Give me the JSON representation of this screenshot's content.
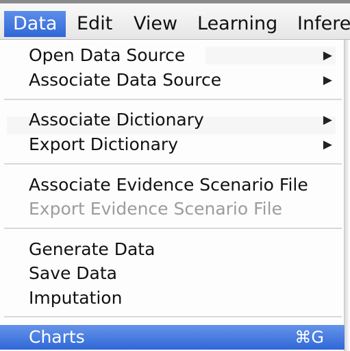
{
  "menubar": {
    "items": [
      {
        "label": "Data"
      },
      {
        "label": "Edit"
      },
      {
        "label": "View"
      },
      {
        "label": "Learning"
      },
      {
        "label": "Infere"
      }
    ]
  },
  "menu": {
    "groups": [
      [
        {
          "label": "Open Data Source",
          "submenu": true
        },
        {
          "label": "Associate Data Source",
          "submenu": true
        }
      ],
      [
        {
          "label": "Associate Dictionary",
          "submenu": true
        },
        {
          "label": "Export Dictionary",
          "submenu": true
        }
      ],
      [
        {
          "label": "Associate Evidence Scenario File"
        },
        {
          "label": "Export Evidence Scenario File",
          "disabled": true
        }
      ],
      [
        {
          "label": "Generate Data"
        },
        {
          "label": "Save Data"
        },
        {
          "label": "Imputation"
        }
      ],
      [
        {
          "label": "Charts",
          "shortcut": "⌘G",
          "highlighted": true
        }
      ]
    ],
    "arrow_glyph": "▶"
  },
  "colors": {
    "highlight": "#2f67d6",
    "disabled_text": "#9c9c9c"
  }
}
